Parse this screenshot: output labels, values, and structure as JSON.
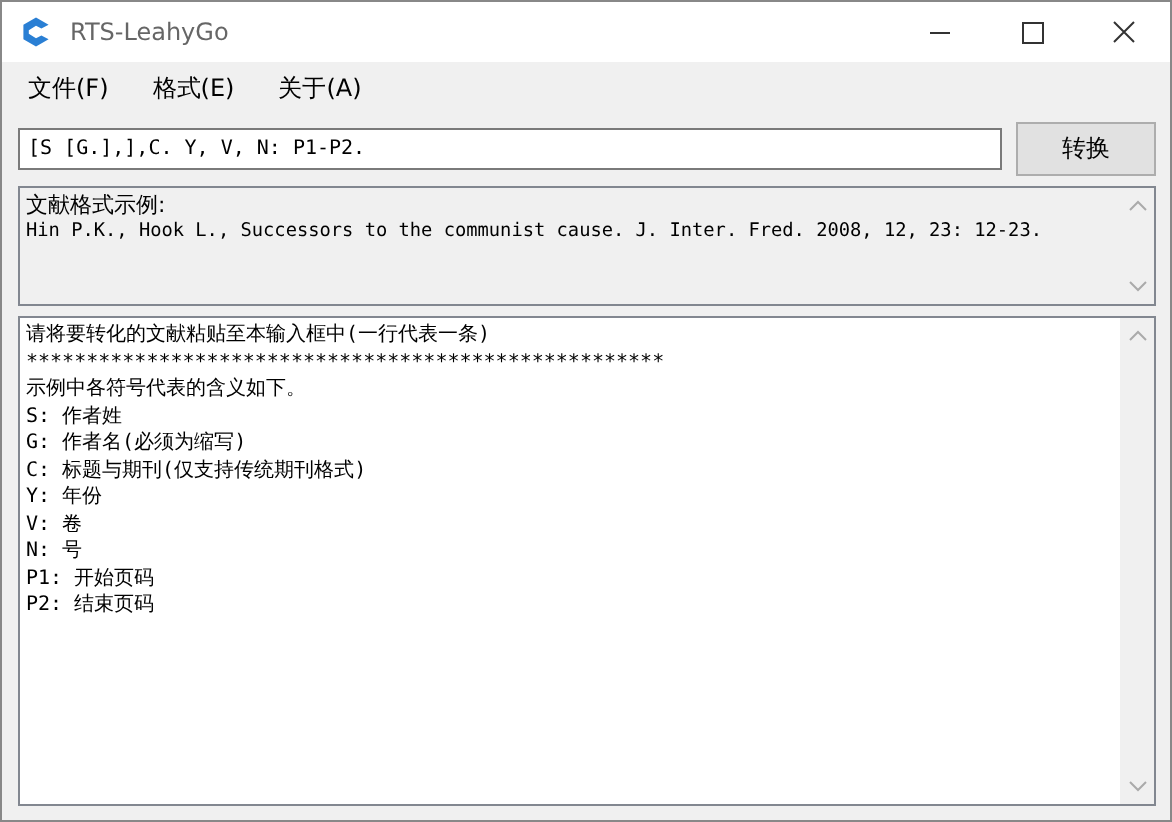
{
  "window": {
    "title": "RTS-LeahyGo"
  },
  "menu": [
    "文件(F)",
    "格式(E)",
    "关于(A)"
  ],
  "format_field": {
    "value": "[S [G.],],C. Y, V, N: P1-P2."
  },
  "convert_button": "转换",
  "example": {
    "heading": "文献格式示例:",
    "text": "Hin P.K., Hook L., Successors to the communist cause. J. Inter. Fred. 2008, 12, 23: 12-23."
  },
  "input_area": {
    "lines": [
      "请将要转化的文献粘贴至本输入框中(一行代表一条)",
      "*****************************************************",
      "示例中各符号代表的含义如下。",
      "S: 作者姓",
      "G: 作者名(必须为缩写)",
      "C: 标题与期刊(仅支持传统期刊格式)",
      "Y: 年份",
      "V: 卷",
      "N: 号",
      "P1: 开始页码",
      "P2: 结束页码"
    ]
  }
}
